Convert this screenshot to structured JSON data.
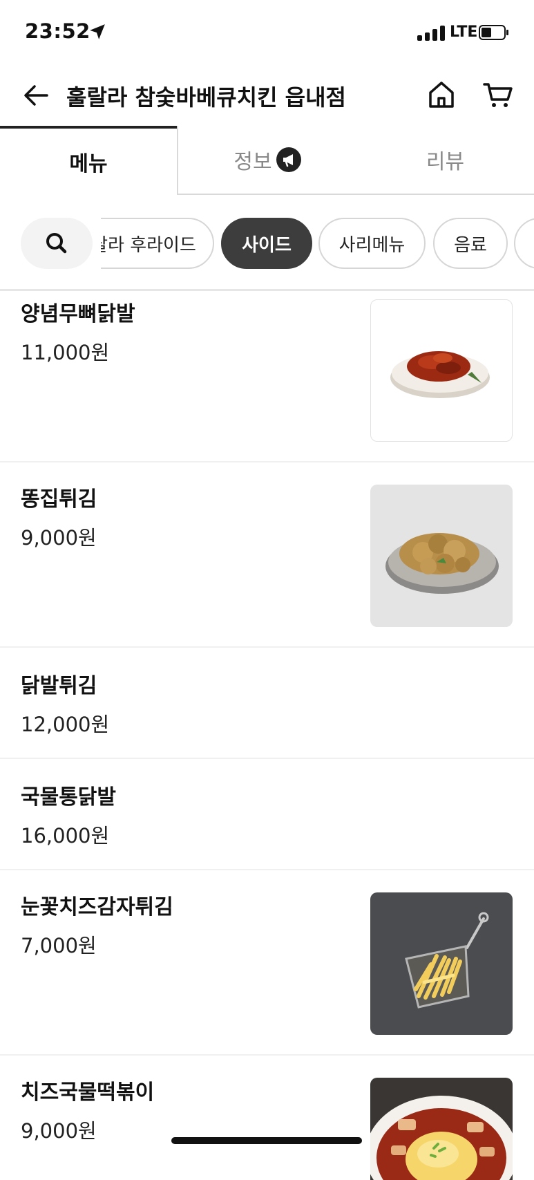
{
  "status_bar": {
    "time": "23:52",
    "network": "LTE",
    "icons": [
      "location-arrow-icon",
      "signal-icon",
      "battery-icon"
    ]
  },
  "header": {
    "title": "훌랄라 참숯바베큐치킨 읍내점",
    "icons": [
      "back-arrow-icon",
      "home-icon",
      "cart-icon"
    ]
  },
  "tabs": [
    {
      "label": "메뉴",
      "selected": true
    },
    {
      "label": "정보",
      "selected": false,
      "icon": "megaphone-icon"
    },
    {
      "label": "리뷰",
      "selected": false
    }
  ],
  "categories": {
    "search_icon": "search-icon",
    "items": [
      {
        "label": "랄라 후라이드",
        "active": false
      },
      {
        "label": "사이드",
        "active": true
      },
      {
        "label": "사리메뉴",
        "active": false
      },
      {
        "label": "음료",
        "active": false
      },
      {
        "label": "",
        "active": false
      }
    ]
  },
  "menu": [
    {
      "name": "양념무뼈닭발",
      "price": "11,000원",
      "image": "spicy-boneless-chicken-feet-photo"
    },
    {
      "name": "똥집튀김",
      "price": "9,000원",
      "image": "fried-gizzard-photo"
    },
    {
      "name": "닭발튀김",
      "price": "12,000원",
      "image": null
    },
    {
      "name": "국물통닭발",
      "price": "16,000원",
      "image": null
    },
    {
      "name": "눈꽃치즈감자튀김",
      "price": "7,000원",
      "image": "cheese-fries-basket-photo"
    },
    {
      "name": "치즈국물떡볶이",
      "price": "9,000원",
      "image": "cheese-tteokbokki-photo"
    }
  ],
  "colors": {
    "active_chip": "#3d3d3d",
    "tab_indicator": "#222222",
    "muted_text": "#888888",
    "divider": "#f0f0f0"
  }
}
